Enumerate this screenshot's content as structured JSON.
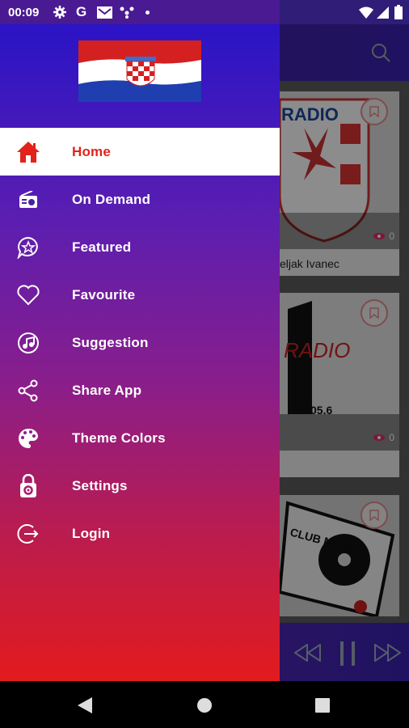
{
  "status_bar": {
    "time": "00:09",
    "left_icons": [
      "gear-icon",
      "google-icon",
      "mail-icon",
      "network-icon",
      "dot-icon"
    ],
    "right_icons": [
      "wifi-icon",
      "signal-icon",
      "battery-icon"
    ]
  },
  "background": {
    "cards": [
      {
        "image_text": "RADIO",
        "views": "0",
        "title": "eljak Ivanec"
      },
      {
        "image_text": "RADIO",
        "views": "0"
      },
      {
        "image_text": "CLUB MUSIC"
      }
    ]
  },
  "drawer": {
    "header": {
      "logo": "croatian-flag"
    },
    "items": [
      {
        "label": "Home",
        "icon": "home-icon",
        "active": true
      },
      {
        "label": "On Demand",
        "icon": "radio-icon"
      },
      {
        "label": "Featured",
        "icon": "star-chat-icon"
      },
      {
        "label": "Favourite",
        "icon": "heart-icon"
      },
      {
        "label": "Suggestion",
        "icon": "music-note-icon"
      },
      {
        "label": "Share App",
        "icon": "share-icon"
      },
      {
        "label": "Theme Colors",
        "icon": "palette-icon"
      },
      {
        "label": "Settings",
        "icon": "gear-lock-icon"
      },
      {
        "label": "Login",
        "icon": "login-icon"
      }
    ]
  },
  "colors": {
    "active_text": "#e2231a",
    "drawer_top": "#2a14c6",
    "drawer_bottom": "#e31b1d"
  }
}
